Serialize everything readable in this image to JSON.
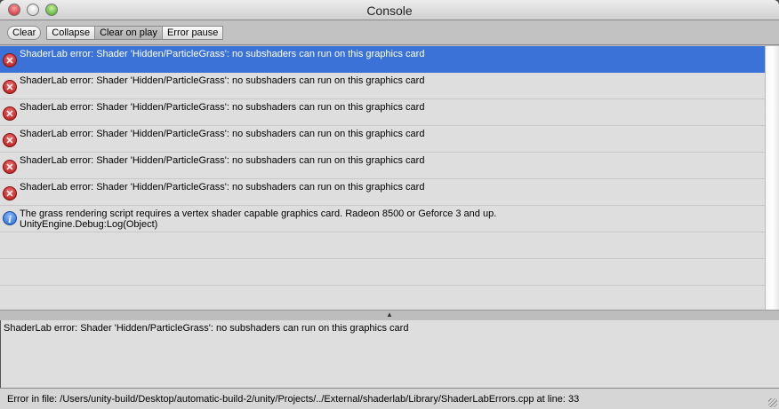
{
  "window": {
    "title": "Console"
  },
  "toolbar": {
    "clear": "Clear",
    "collapse": "Collapse",
    "clear_on_play": "Clear on play",
    "error_pause": "Error pause"
  },
  "log": [
    {
      "type": "error",
      "line1": "ShaderLab error: Shader 'Hidden/ParticleGrass': no subshaders can run on this graphics card",
      "selected": true
    },
    {
      "type": "error",
      "line1": "ShaderLab error: Shader 'Hidden/ParticleGrass': no subshaders can run on this graphics card"
    },
    {
      "type": "error",
      "line1": "ShaderLab error: Shader 'Hidden/ParticleGrass': no subshaders can run on this graphics card"
    },
    {
      "type": "error",
      "line1": "ShaderLab error: Shader 'Hidden/ParticleGrass': no subshaders can run on this graphics card"
    },
    {
      "type": "error",
      "line1": "ShaderLab error: Shader 'Hidden/ParticleGrass': no subshaders can run on this graphics card"
    },
    {
      "type": "error",
      "line1": "ShaderLab error: Shader 'Hidden/ParticleGrass': no subshaders can run on this graphics card"
    },
    {
      "type": "info",
      "line1": "The grass rendering script requires a vertex shader capable graphics card. Radeon 8500 or Geforce 3 and up.",
      "line2": "UnityEngine.Debug:Log(Object)"
    }
  ],
  "icons": {
    "error": "✕",
    "info": "i"
  },
  "divider_glyph": "▲",
  "detail": "ShaderLab error: Shader 'Hidden/ParticleGrass': no subshaders can run on this graphics card",
  "status": "Error in file: /Users/unity-build/Desktop/automatic-build-2/unity/Projects/../External/shaderlab/Library/ShaderLabErrors.cpp at line: 33"
}
